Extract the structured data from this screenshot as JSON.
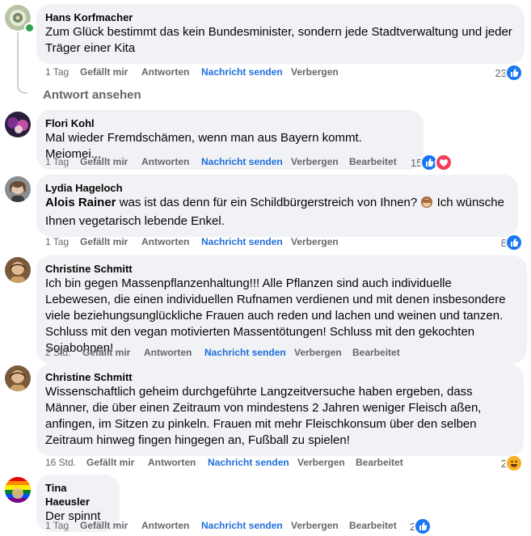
{
  "view_replies": "Antwort ansehen",
  "colors": {
    "like_blue": "#1877f2",
    "heart_red": "#f33e58",
    "link_blue": "#216fdb",
    "muted": "#65676b",
    "bubble_bg": "#f0f2f5"
  },
  "actions": {
    "like": "Gefällt mir",
    "reply": "Antworten",
    "message": "Nachricht senden",
    "hide": "Verbergen",
    "edited": "Bearbeitet"
  },
  "comments": [
    {
      "author": "Hans Korfmacher",
      "text": "Zum Glück bestimmt das kein Bundesminister, sondern jede Stadtverwaltung und jeder Träger einer Kita",
      "time": "1 Tag",
      "reaction_count": "23",
      "reactions": [
        "like-icon"
      ]
    },
    {
      "author": "Flori Kohl",
      "text": "Mal wieder Fremdschämen, wenn man aus Bayern kommt. Meiomei...",
      "time": "1 Tag",
      "reaction_count": "15",
      "reactions": [
        "like-icon",
        "heart-icon"
      ]
    },
    {
      "author": "Lydia Hageloch",
      "mention": "Alois Rainer",
      "text_before_emoji": " was ist das denn für ein Schildbürgerstreich von Ihnen?",
      "emoji": "see-no-evil-monkey-emoji",
      "text_after_emoji": " Ich wünsche Ihnen vegetarisch lebende Enkel.",
      "time": "1 Tag",
      "reaction_count": "8",
      "reactions": [
        "like-icon"
      ]
    },
    {
      "author": "Christine Schmitt",
      "text": "Ich bin gegen Massenpflanzenhaltung!!! Alle Pflanzen sind auch individuelle Lebewesen, die einen individuellen Rufnamen verdienen und mit denen insbesondere viele beziehungsunglückliche Frauen auch reden und lachen und weinen und tanzen. Schluss mit den vegan motivierten Massentötungen! Schluss mit den gekochten Sojabohnen!",
      "time": "2 Std."
    },
    {
      "author": "Christine Schmitt",
      "text": "Wissenschaftlich geheim durchgeführte Langzeitversuche haben ergeben, dass Männer, die über einen Zeitraum von mindestens 2 Jahren weniger Fleisch aßen, anfingen, im Sitzen zu pinkeln. Frauen mit mehr Fleischkonsum über den selben Zeitraum hinweg fingen hingegen an, Fußball zu spielen!",
      "time": "16 Std.",
      "reaction_count": "2",
      "reactions": [
        "laughing-icon"
      ]
    },
    {
      "author": "Tina Haeusler",
      "text": "Der spinnt",
      "time": "1 Tag",
      "reaction_count": "2",
      "reactions": [
        "like-icon"
      ]
    }
  ]
}
